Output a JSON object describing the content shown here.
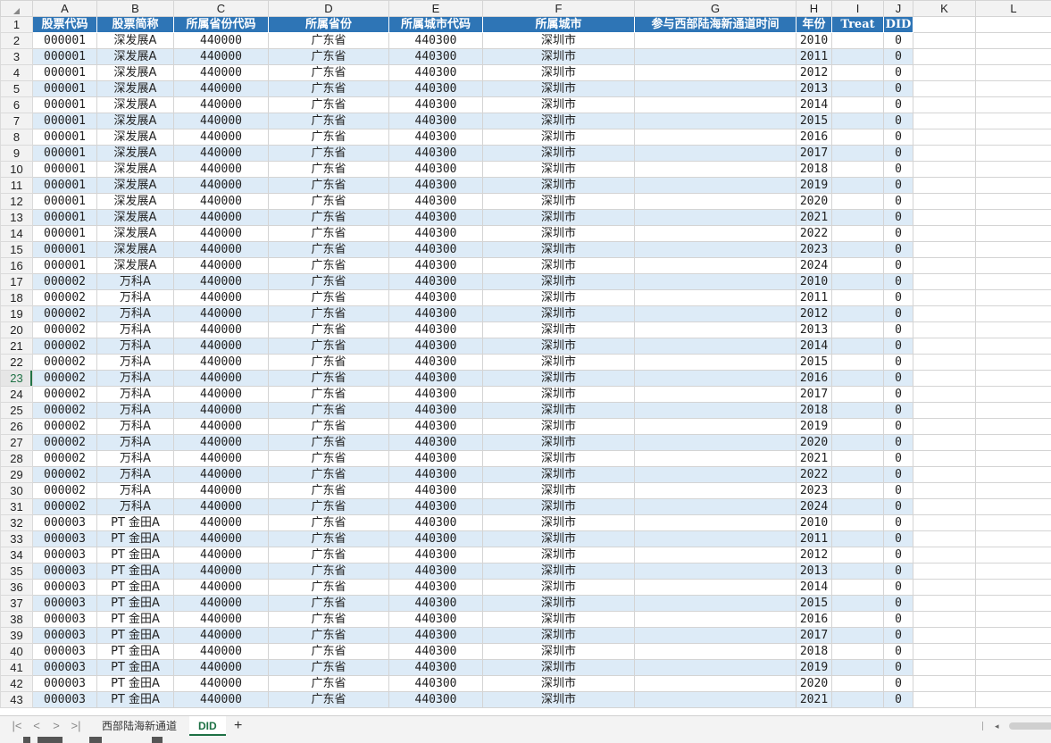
{
  "columns": [
    "A",
    "B",
    "C",
    "D",
    "E",
    "F",
    "G",
    "H",
    "I",
    "J",
    "K",
    "L"
  ],
  "header": [
    "股票代码",
    "股票简称",
    "所属省份代码",
    "所属省份",
    "所属城市代码",
    "所属城市",
    "参与西部陆海新通道时间",
    "年份",
    "Treat",
    "DID"
  ],
  "rows": [
    [
      "000001",
      "深发展A",
      "440000",
      "广东省",
      "440300",
      "深圳市",
      "",
      "2010",
      "",
      "0"
    ],
    [
      "000001",
      "深发展A",
      "440000",
      "广东省",
      "440300",
      "深圳市",
      "",
      "2011",
      "",
      "0"
    ],
    [
      "000001",
      "深发展A",
      "440000",
      "广东省",
      "440300",
      "深圳市",
      "",
      "2012",
      "",
      "0"
    ],
    [
      "000001",
      "深发展A",
      "440000",
      "广东省",
      "440300",
      "深圳市",
      "",
      "2013",
      "",
      "0"
    ],
    [
      "000001",
      "深发展A",
      "440000",
      "广东省",
      "440300",
      "深圳市",
      "",
      "2014",
      "",
      "0"
    ],
    [
      "000001",
      "深发展A",
      "440000",
      "广东省",
      "440300",
      "深圳市",
      "",
      "2015",
      "",
      "0"
    ],
    [
      "000001",
      "深发展A",
      "440000",
      "广东省",
      "440300",
      "深圳市",
      "",
      "2016",
      "",
      "0"
    ],
    [
      "000001",
      "深发展A",
      "440000",
      "广东省",
      "440300",
      "深圳市",
      "",
      "2017",
      "",
      "0"
    ],
    [
      "000001",
      "深发展A",
      "440000",
      "广东省",
      "440300",
      "深圳市",
      "",
      "2018",
      "",
      "0"
    ],
    [
      "000001",
      "深发展A",
      "440000",
      "广东省",
      "440300",
      "深圳市",
      "",
      "2019",
      "",
      "0"
    ],
    [
      "000001",
      "深发展A",
      "440000",
      "广东省",
      "440300",
      "深圳市",
      "",
      "2020",
      "",
      "0"
    ],
    [
      "000001",
      "深发展A",
      "440000",
      "广东省",
      "440300",
      "深圳市",
      "",
      "2021",
      "",
      "0"
    ],
    [
      "000001",
      "深发展A",
      "440000",
      "广东省",
      "440300",
      "深圳市",
      "",
      "2022",
      "",
      "0"
    ],
    [
      "000001",
      "深发展A",
      "440000",
      "广东省",
      "440300",
      "深圳市",
      "",
      "2023",
      "",
      "0"
    ],
    [
      "000001",
      "深发展A",
      "440000",
      "广东省",
      "440300",
      "深圳市",
      "",
      "2024",
      "",
      "0"
    ],
    [
      "000002",
      "万科A",
      "440000",
      "广东省",
      "440300",
      "深圳市",
      "",
      "2010",
      "",
      "0"
    ],
    [
      "000002",
      "万科A",
      "440000",
      "广东省",
      "440300",
      "深圳市",
      "",
      "2011",
      "",
      "0"
    ],
    [
      "000002",
      "万科A",
      "440000",
      "广东省",
      "440300",
      "深圳市",
      "",
      "2012",
      "",
      "0"
    ],
    [
      "000002",
      "万科A",
      "440000",
      "广东省",
      "440300",
      "深圳市",
      "",
      "2013",
      "",
      "0"
    ],
    [
      "000002",
      "万科A",
      "440000",
      "广东省",
      "440300",
      "深圳市",
      "",
      "2014",
      "",
      "0"
    ],
    [
      "000002",
      "万科A",
      "440000",
      "广东省",
      "440300",
      "深圳市",
      "",
      "2015",
      "",
      "0"
    ],
    [
      "000002",
      "万科A",
      "440000",
      "广东省",
      "440300",
      "深圳市",
      "",
      "2016",
      "",
      "0"
    ],
    [
      "000002",
      "万科A",
      "440000",
      "广东省",
      "440300",
      "深圳市",
      "",
      "2017",
      "",
      "0"
    ],
    [
      "000002",
      "万科A",
      "440000",
      "广东省",
      "440300",
      "深圳市",
      "",
      "2018",
      "",
      "0"
    ],
    [
      "000002",
      "万科A",
      "440000",
      "广东省",
      "440300",
      "深圳市",
      "",
      "2019",
      "",
      "0"
    ],
    [
      "000002",
      "万科A",
      "440000",
      "广东省",
      "440300",
      "深圳市",
      "",
      "2020",
      "",
      "0"
    ],
    [
      "000002",
      "万科A",
      "440000",
      "广东省",
      "440300",
      "深圳市",
      "",
      "2021",
      "",
      "0"
    ],
    [
      "000002",
      "万科A",
      "440000",
      "广东省",
      "440300",
      "深圳市",
      "",
      "2022",
      "",
      "0"
    ],
    [
      "000002",
      "万科A",
      "440000",
      "广东省",
      "440300",
      "深圳市",
      "",
      "2023",
      "",
      "0"
    ],
    [
      "000002",
      "万科A",
      "440000",
      "广东省",
      "440300",
      "深圳市",
      "",
      "2024",
      "",
      "0"
    ],
    [
      "000003",
      "PT 金田A",
      "440000",
      "广东省",
      "440300",
      "深圳市",
      "",
      "2010",
      "",
      "0"
    ],
    [
      "000003",
      "PT 金田A",
      "440000",
      "广东省",
      "440300",
      "深圳市",
      "",
      "2011",
      "",
      "0"
    ],
    [
      "000003",
      "PT 金田A",
      "440000",
      "广东省",
      "440300",
      "深圳市",
      "",
      "2012",
      "",
      "0"
    ],
    [
      "000003",
      "PT 金田A",
      "440000",
      "广东省",
      "440300",
      "深圳市",
      "",
      "2013",
      "",
      "0"
    ],
    [
      "000003",
      "PT 金田A",
      "440000",
      "广东省",
      "440300",
      "深圳市",
      "",
      "2014",
      "",
      "0"
    ],
    [
      "000003",
      "PT 金田A",
      "440000",
      "广东省",
      "440300",
      "深圳市",
      "",
      "2015",
      "",
      "0"
    ],
    [
      "000003",
      "PT 金田A",
      "440000",
      "广东省",
      "440300",
      "深圳市",
      "",
      "2016",
      "",
      "0"
    ],
    [
      "000003",
      "PT 金田A",
      "440000",
      "广东省",
      "440300",
      "深圳市",
      "",
      "2017",
      "",
      "0"
    ],
    [
      "000003",
      "PT 金田A",
      "440000",
      "广东省",
      "440300",
      "深圳市",
      "",
      "2018",
      "",
      "0"
    ],
    [
      "000003",
      "PT 金田A",
      "440000",
      "广东省",
      "440300",
      "深圳市",
      "",
      "2019",
      "",
      "0"
    ],
    [
      "000003",
      "PT 金田A",
      "440000",
      "广东省",
      "440300",
      "深圳市",
      "",
      "2020",
      "",
      "0"
    ],
    [
      "000003",
      "PT 金田A",
      "440000",
      "广东省",
      "440300",
      "深圳市",
      "",
      "2021",
      "",
      "0"
    ]
  ],
  "active_row": 23,
  "tabs": {
    "sheet1": "西部陆海新通道",
    "sheet2": "DID",
    "add": "+"
  },
  "nav": {
    "first": "|<",
    "prev": "<",
    "next": ">",
    "last": ">|"
  },
  "colors": {
    "header_fill": "#2e75b6",
    "band_fill": "#ddebf7",
    "active_tab": "#1e7145"
  }
}
